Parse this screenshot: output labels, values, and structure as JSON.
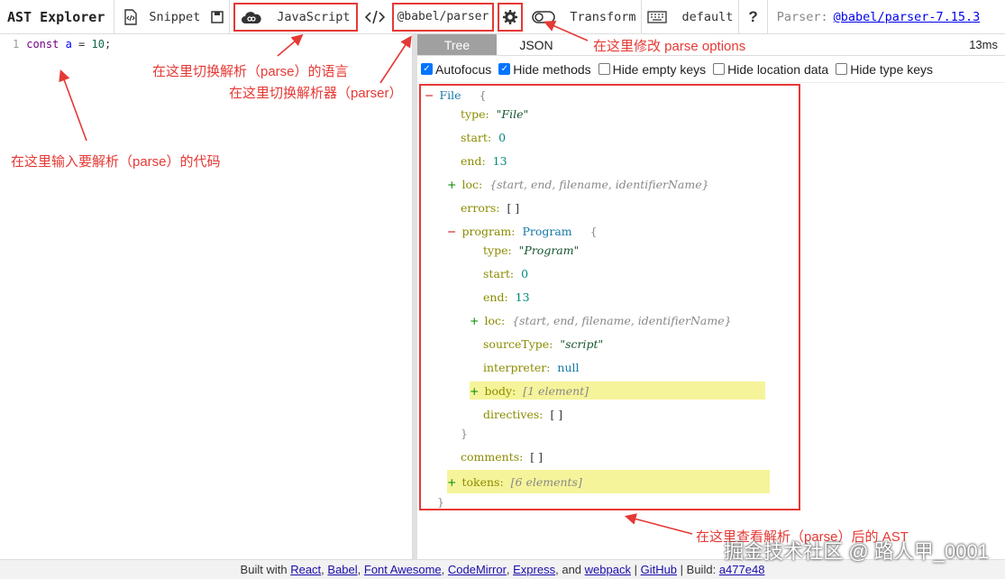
{
  "toolbar": {
    "title": "AST Explorer",
    "snippet": "Snippet",
    "language": "JavaScript",
    "parser": "@babel/parser",
    "transform": "Transform",
    "keymap": "default",
    "help": "?",
    "parser_prefix": "Parser:",
    "parser_version": "@babel/parser-7.15.3"
  },
  "editor": {
    "line_no": "1",
    "kw": "const",
    "var": "a",
    "op": " = ",
    "num": "10",
    "end": ";"
  },
  "output": {
    "tabs": [
      "Tree",
      "JSON"
    ],
    "timer": "13ms",
    "options": [
      {
        "label": "Autofocus",
        "checked": true
      },
      {
        "label": "Hide methods",
        "checked": true
      },
      {
        "label": "Hide empty keys",
        "checked": false
      },
      {
        "label": "Hide location data",
        "checked": false
      },
      {
        "label": "Hide type keys",
        "checked": false
      }
    ]
  },
  "tree": {
    "file": "File",
    "brace_open": "{",
    "brace_close": "}",
    "type_k": "type:",
    "file_v": "\"File\"",
    "start_k": "start:",
    "start_v": "0",
    "end_k": "end:",
    "end_v": "13",
    "loc_k": "loc:",
    "loc_v": "{start, end, filename, identifierName}",
    "errors_k": "errors:",
    "errors_v": "[ ]",
    "program_k": "program:",
    "program_v": "Program",
    "program_type_v": "\"Program\"",
    "sourcetype_k": "sourceType:",
    "sourcetype_v": "\"script\"",
    "interpreter_k": "interpreter:",
    "interpreter_v": "null",
    "body_k": "body:",
    "body_v": "[1 element]",
    "directives_k": "directives:",
    "directives_v": "[ ]",
    "comments_k": "comments:",
    "comments_v": "[ ]",
    "tokens_k": "tokens:",
    "tokens_v": "[6 elements]",
    "minus": "−",
    "plus": "+"
  },
  "annotations": {
    "lang": "在这里切换解析（parse）的语言",
    "parser": "在这里切换解析器（parser）",
    "options": "在这里修改 parse options",
    "code": "在这里输入要解析（parse）的代码",
    "ast": "在这里查看解析（parse）后的 AST"
  },
  "footer": {
    "built_with": "Built with",
    "react": "React",
    "babel": "Babel",
    "fontawesome": "Font Awesome",
    "codemirror": "CodeMirror",
    "express": "Express",
    "and": ", and",
    "webpack": "webpack",
    "github": "GitHub",
    "build": "Build:",
    "hash": "a477e48"
  },
  "watermark": "掘金技术社区 @ 路人甲_0001"
}
